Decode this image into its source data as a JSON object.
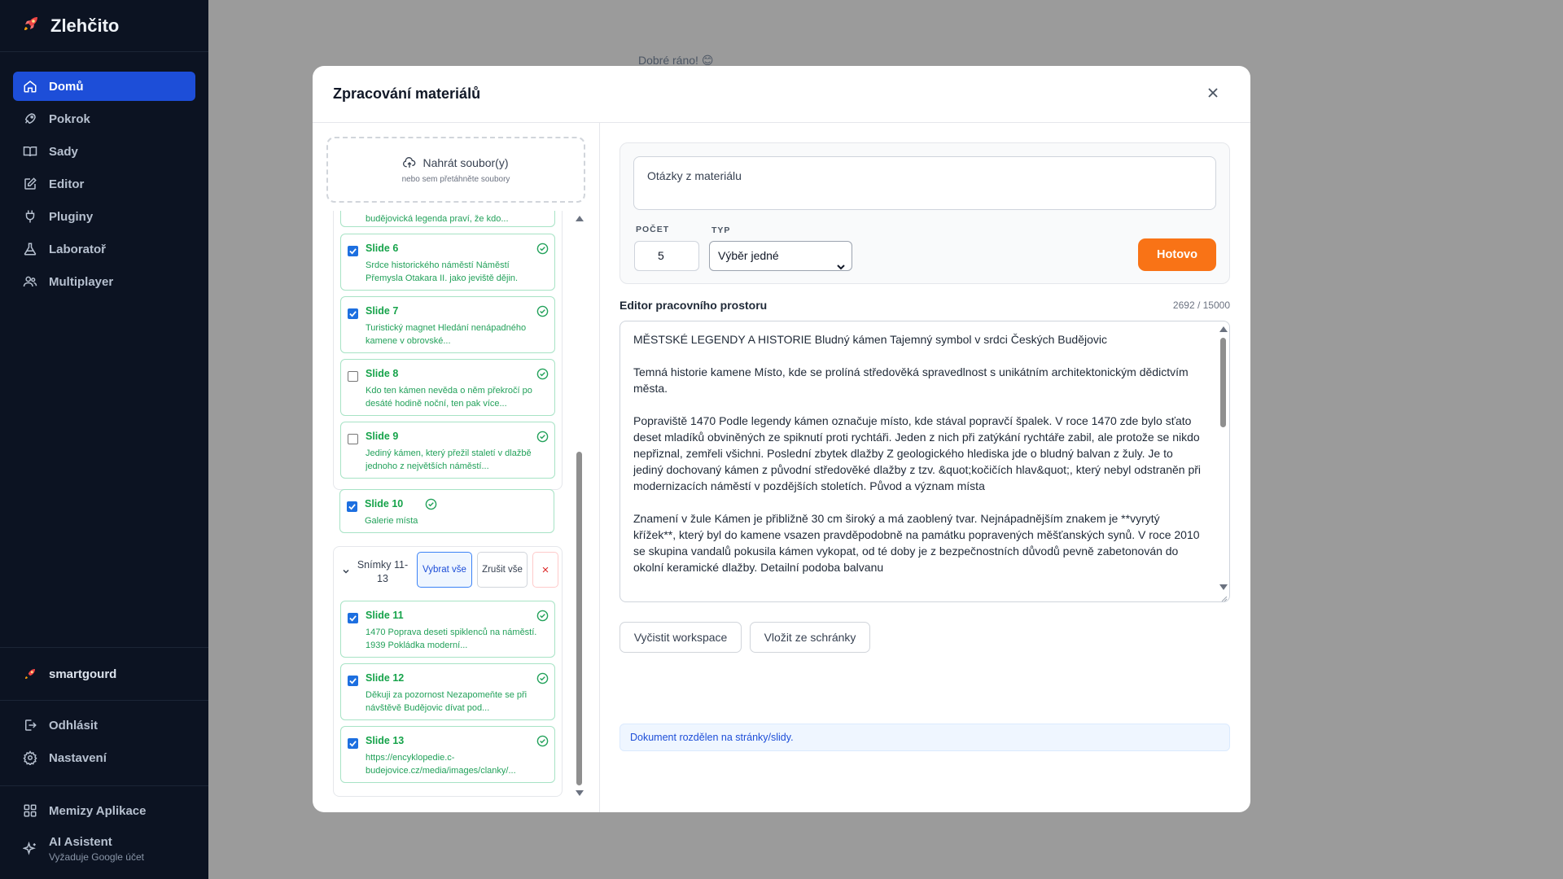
{
  "app": {
    "name": "Zlehčito",
    "greeting": "Dobré ráno! 😊"
  },
  "sidebar": {
    "items": [
      {
        "label": "Domů",
        "icon": "home-icon",
        "active": true
      },
      {
        "label": "Pokrok",
        "icon": "rocket-icon",
        "active": false
      },
      {
        "label": "Sady",
        "icon": "book-icon",
        "active": false
      },
      {
        "label": "Editor",
        "icon": "edit-icon",
        "active": false
      },
      {
        "label": "Pluginy",
        "icon": "plug-icon",
        "active": false
      },
      {
        "label": "Laboratoř",
        "icon": "flask-icon",
        "active": false
      },
      {
        "label": "Multiplayer",
        "icon": "users-icon",
        "active": false
      }
    ],
    "user": "smartgourd",
    "logout": "Odhlásit",
    "settings": "Nastavení",
    "apps": "Memizy Aplikace",
    "ai_title": "AI Asistent",
    "ai_sub": "Vyžaduje Google účet"
  },
  "modal": {
    "title": "Zpracování materiálů",
    "upload": {
      "label": "Nahrát soubor(y)",
      "hint": "nebo sem přetáhněte soubory"
    },
    "partial_text": "budějovická legenda praví, že kdo...",
    "slides_a": [
      {
        "title": "Slide 6",
        "desc": "Srdce historického náměstí Náměstí Přemysla Otakara II. jako jeviště dějin.",
        "checked": true
      },
      {
        "title": "Slide 7",
        "desc": "Turistický magnet Hledání nenápadného kamene v obrovské...",
        "checked": true
      },
      {
        "title": "Slide 8",
        "desc": "Kdo ten kámen nevěda o něm překročí po desáté hodině noční, ten pak více...",
        "checked": false
      },
      {
        "title": "Slide 9",
        "desc": "Jediný kámen, který přežil staletí v dlažbě jednoho z největších náměstí...",
        "checked": false
      },
      {
        "title": "Slide 10",
        "desc": "Galerie místa",
        "checked": true
      }
    ],
    "group2": {
      "label": "Snímky 11-13",
      "select_all": "Vybrat vše",
      "clear_all": "Zrušit vše",
      "delete": "×"
    },
    "slides_b": [
      {
        "title": "Slide 11",
        "desc": "1470 Poprava deseti spiklenců na náměstí. 1939 Pokládka moderní...",
        "checked": true
      },
      {
        "title": "Slide 12",
        "desc": "Děkuji za pozornost Nezapomeňte se při návštěvě Budějovic dívat pod...",
        "checked": true
      },
      {
        "title": "Slide 13",
        "desc": "https://encyklopedie.c-budejovice.cz/media/images/clanky/...",
        "checked": true
      }
    ],
    "questions": {
      "prompt": "Otázky z materiálu",
      "count_label": "POČET",
      "count_value": "5",
      "type_label": "TYP",
      "type_value": "Výběr jedné",
      "done": "Hotovo"
    },
    "editor": {
      "title": "Editor pracovního prostoru",
      "count": "2692 / 15000",
      "paragraphs": [
        "MĚSTSKÉ LEGENDY A HISTORIE Bludný kámen Tajemný symbol v srdci Českých Budějovic",
        "Temná historie kamene Místo, kde se prolíná středověká spravedlnost s unikátním architektonickým dědictvím města.",
        "Popraviště 1470 Podle legendy kámen označuje místo, kde stával popravčí špalek. V roce 1470 zde bylo sťato deset mladíků obviněných ze spiknutí proti rychtáři. Jeden z nich při zatýkání rychtáře zabil, ale protože se nikdo nepřiznal, zemřeli všichni. Poslední zbytek dlažby Z geologického hlediska jde o bludný balvan z žuly. Je to jediný dochovaný kámen z původní středověké dlažby z tzv. &quot;kočičích hlav&quot;, který nebyl odstraněn při modernizacích náměstí v pozdějších stoletích. Původ a význam místa",
        "Znamení v žule Kámen je přibližně 30 cm široký a má zaoblený tvar. Nejnápadnějším znakem je **vyrytý křížek**, který byl do kamene vsazen pravděpodobně na památku popravených měšťanských synů. V roce 2010 se skupina vandalů pokusila kámen vykopat, od té doby je z bezpečnostních důvodů pevně zabetonován do okolní keramické dlažby. Detailní podoba balvanu"
      ],
      "clear_btn": "Vyčistit workspace",
      "paste_btn": "Vložit ze schránky",
      "info": "Dokument rozdělen na stránky/slidy."
    }
  }
}
